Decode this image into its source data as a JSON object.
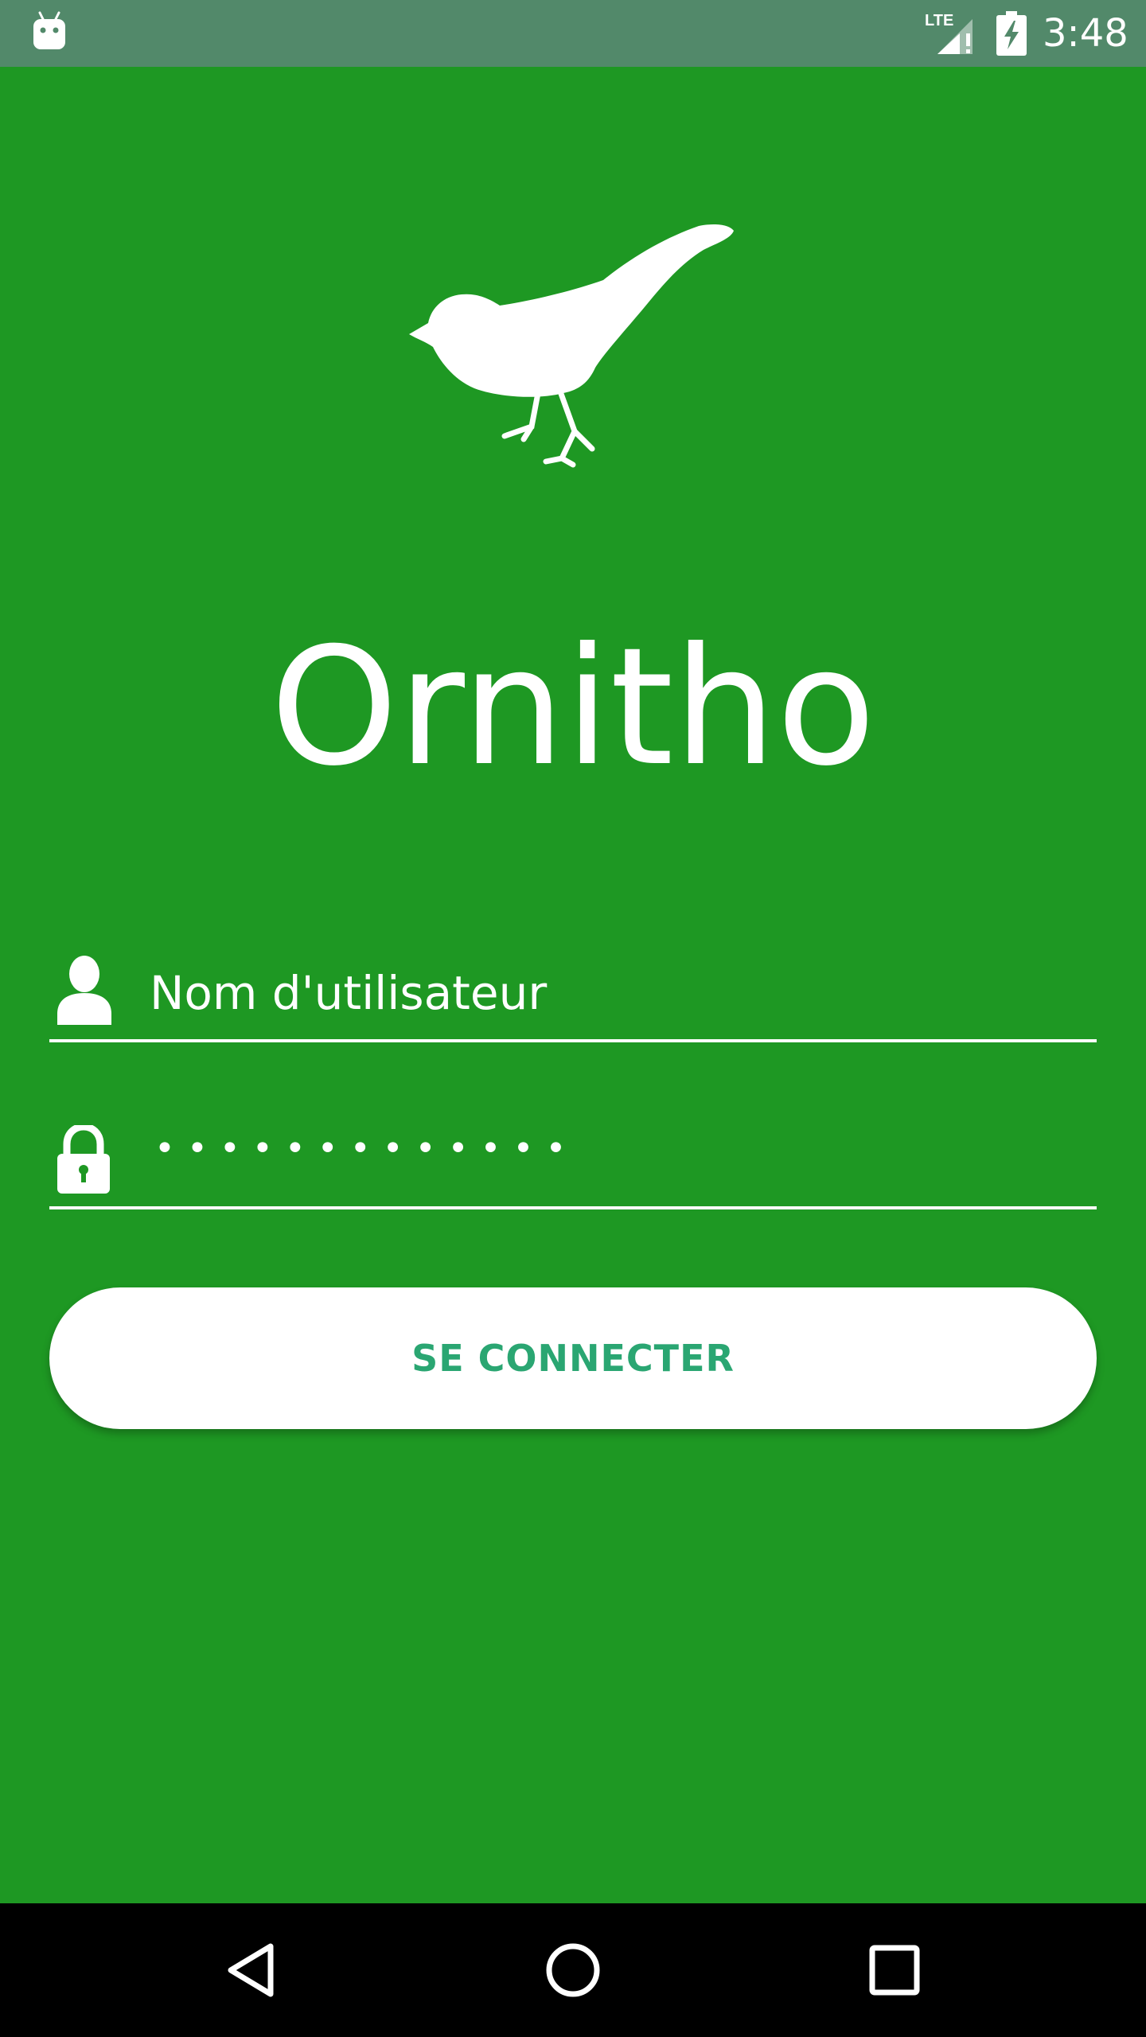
{
  "status_bar": {
    "time": "3:48",
    "network": "LTE",
    "background_color": "#52896a",
    "icons": [
      "android-icon",
      "lte-signal-icon",
      "battery-charging-icon"
    ]
  },
  "app": {
    "title": "Ornitho",
    "logo_icon": "bird-icon",
    "background_color": "#1e9823"
  },
  "login_form": {
    "username": {
      "placeholder": "Nom d'utilisateur",
      "value": "",
      "icon": "user-icon"
    },
    "password": {
      "masked_value": "•••••••••••••",
      "icon": "lock-icon"
    },
    "submit_label": "SE CONNECTER",
    "submit_text_color": "#2aa672"
  },
  "nav_bar": {
    "buttons": [
      "back-icon",
      "home-icon",
      "recents-icon"
    ]
  }
}
